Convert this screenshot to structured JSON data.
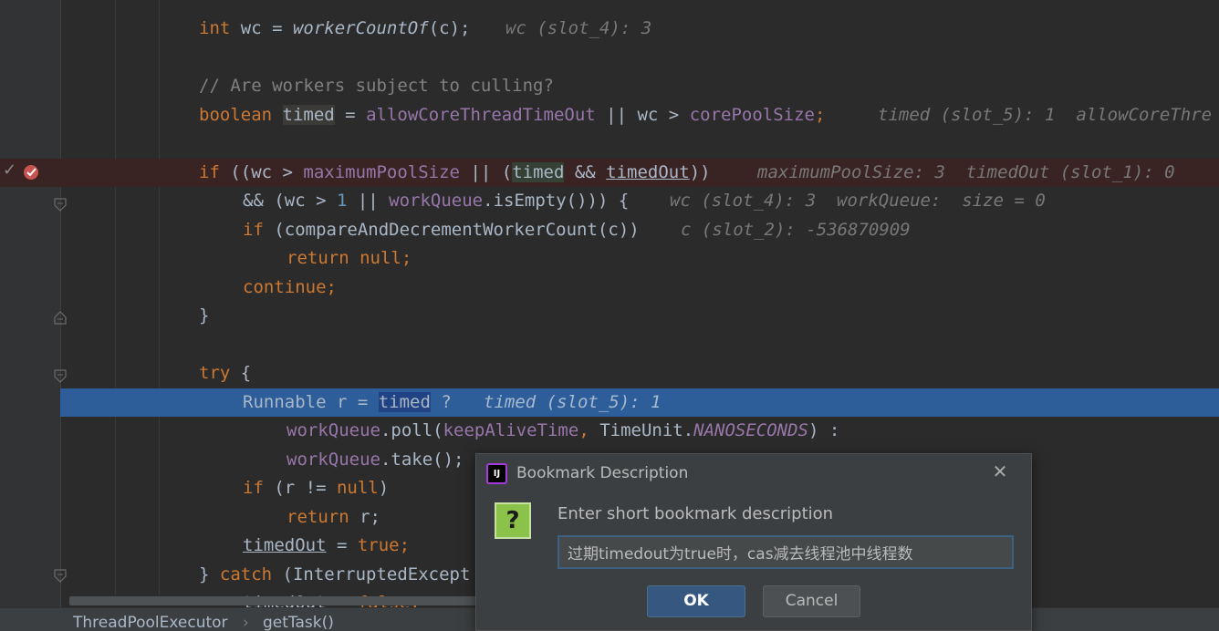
{
  "editor": {
    "line1": {
      "t1": "int",
      "t2": " wc = ",
      "t3": "workerCountOf",
      "t4": "(c);",
      "hint": "wc (slot_4): 3"
    },
    "line3": {
      "comment": "// Are workers subject to culling?"
    },
    "line4": {
      "t1": "boolean",
      "t2": " ",
      "t3": "timed",
      "t4": " = ",
      "t5": "allowCoreThreadTimeOut",
      "t6": " || wc > ",
      "t7": "corePoolSize",
      "t8": ";",
      "hint": "timed (slot_5): 1  allowCoreThre"
    },
    "line6": {
      "t1": "if",
      "t2": " ((wc > ",
      "t3": "maximumPoolSize",
      "t4": " || (",
      "t5": "timed",
      "t6": " && ",
      "t7": "timedOut",
      "t8": "))",
      "hint": "maximumPoolSize: 3  timedOut (slot_1): 0"
    },
    "line7": {
      "t1": "&& (wc > ",
      "t2": "1",
      "t3": " || ",
      "t4": "workQueue",
      "t5": ".isEmpty())) {",
      "hint": "wc (slot_4): 3  workQueue:  size = 0"
    },
    "line8": {
      "t1": "if",
      "t2": " (compareAndDecrementWorkerCount(c))",
      "hint": "c (slot_2): -536870909"
    },
    "line9": {
      "t1": "return null",
      "t2": ";"
    },
    "line10": {
      "t1": "continue;"
    },
    "line11": {
      "t1": "}"
    },
    "line13": {
      "t1": "try",
      "t2": " {"
    },
    "line14": {
      "t1": "Runnable r = ",
      "t2": "timed",
      "t3": " ?",
      "hint": "timed (slot_5): 1"
    },
    "line15": {
      "t1": "workQueue",
      "t2": ".poll(",
      "t3": "keepAliveTime",
      "t4": ", ",
      "t5": "TimeUnit.",
      "t6": "NANOSECONDS",
      "t7": ") :"
    },
    "line16": {
      "t1": "workQueue",
      "t2": ".take();"
    },
    "line17": {
      "t1": "if",
      "t2": " (r != ",
      "t3": "null",
      "t4": ")"
    },
    "line18": {
      "t1": "return",
      "t2": " r;"
    },
    "line19": {
      "t1": "timedOut",
      "t2": " = ",
      "t3": "true",
      "t4": ";"
    },
    "line20": {
      "t1": "} ",
      "t2": "catch",
      "t3": " (InterruptedExcept"
    },
    "line21": {
      "t1": "timedOut",
      "t2": " = ",
      "t3": "false",
      "t4": ";"
    }
  },
  "gutter": {
    "check_glyph": "✓",
    "breakpoint_color": "#c75450",
    "exec_line_color": "#2d5e9a"
  },
  "breadcrumb": {
    "class_name": "ThreadPoolExecutor",
    "separator": "›",
    "method_name": "getTask()"
  },
  "dialog": {
    "app_icon_text": "IJ",
    "title": "Bookmark Description",
    "close_glyph": "✕",
    "question_glyph": "?",
    "prompt": "Enter short bookmark description",
    "input_value": "过期timedout为true时，cas减去线程池中线程数",
    "ok_label": "OK",
    "cancel_label": "Cancel"
  }
}
